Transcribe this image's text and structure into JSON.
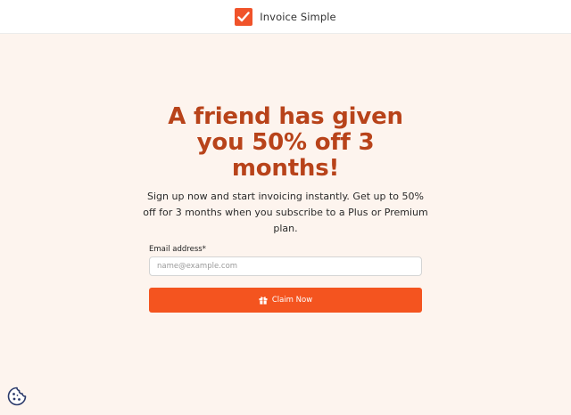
{
  "header": {
    "brand_name": "Invoice Simple",
    "logo_icon": "checkmark-icon",
    "brand_color": "#f0532a"
  },
  "main": {
    "headline": "A friend has given you 50% off 3 months!",
    "headline_color": "#b8431a",
    "subtext": "Sign up now and start invoicing instantly. Get up to 50% off for 3 months when you subscribe to a Plus or Premium plan."
  },
  "form": {
    "email_label": "Email address*",
    "email_value": "",
    "email_placeholder": "name@example.com",
    "submit_label": "Claim Now",
    "submit_icon": "gift-icon",
    "submit_color": "#f4541f"
  },
  "footer": {
    "cookie_icon": "cookie-icon"
  }
}
